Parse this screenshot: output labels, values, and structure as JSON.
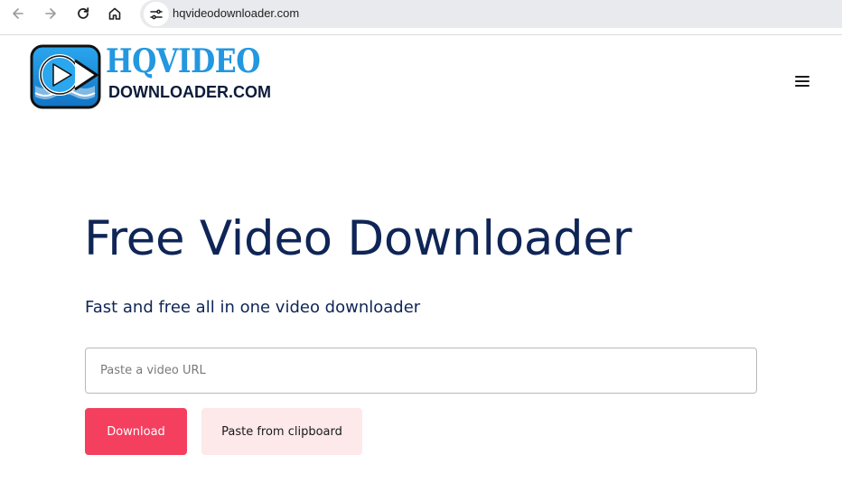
{
  "browser": {
    "url": "hqvideodownloader.com",
    "icons": {
      "back": "arrow-left-icon",
      "forward": "arrow-right-icon",
      "reload": "reload-icon",
      "home": "home-icon",
      "site_info": "tune-icon"
    }
  },
  "header": {
    "logo_top": "HQVIDEO",
    "logo_bottom": "DOWNLOADER.COM",
    "menu_icon": "hamburger-menu-icon"
  },
  "hero": {
    "title": "Free Video Downloader",
    "subtitle": "Fast and free all in one video downloader",
    "input_placeholder": "Paste a video URL",
    "input_value": "",
    "download_label": "Download",
    "paste_label": "Paste from clipboard"
  },
  "colors": {
    "title": "#0f2557",
    "logo_blue": "#2397e0",
    "download_bg": "#f43f5e",
    "paste_bg": "#fde8ea"
  }
}
